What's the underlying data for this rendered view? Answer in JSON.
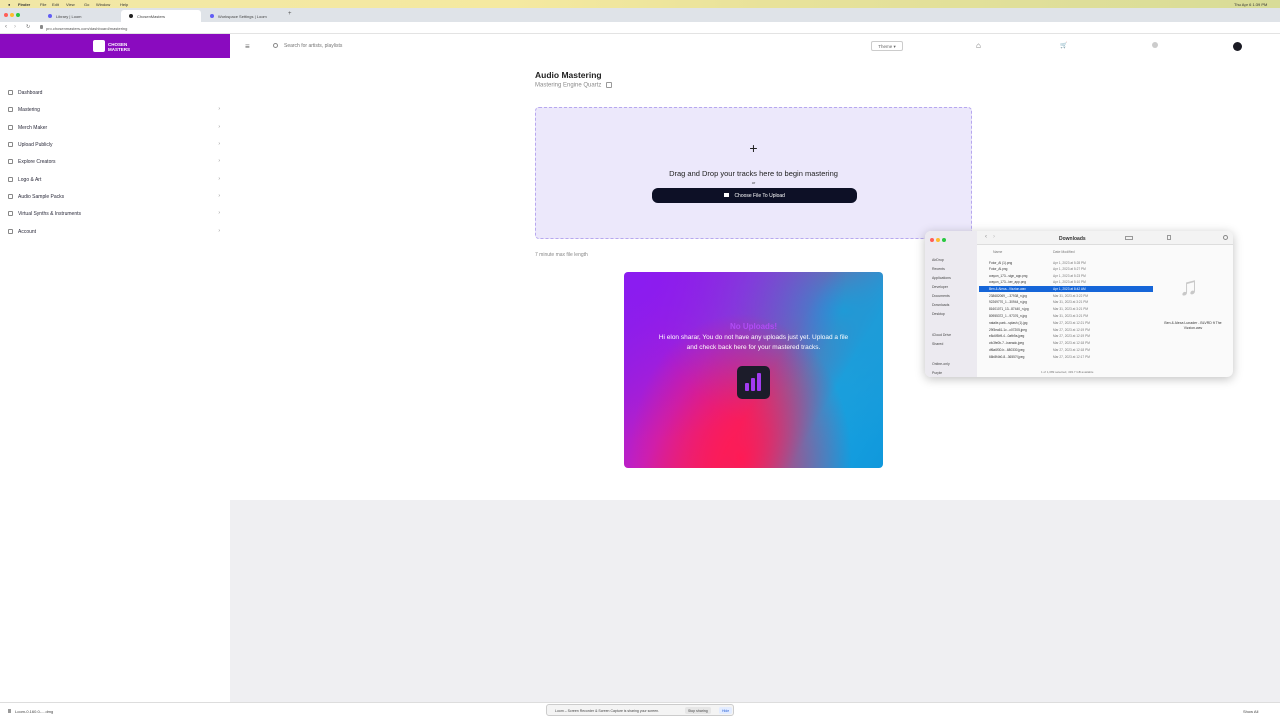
{
  "menubar": {
    "app": "Finder",
    "items": [
      "File",
      "Edit",
      "View",
      "Go",
      "Window",
      "Help"
    ],
    "clock": "Thu Apr 6 1:39 PM"
  },
  "browser": {
    "tabs": [
      {
        "label": "Library | Loom",
        "color": "#625df5"
      },
      {
        "label": "ChosenMasters",
        "color": "#222222"
      },
      {
        "label": "Workspace Settings | Loom",
        "color": "#625df5"
      }
    ],
    "url": "pro.chosenmasters.com/dashboard/mastering"
  },
  "brand": {
    "logo_text_1": "CHOSEN",
    "logo_text_2": "MASTERS",
    "color": "#8a0bbf"
  },
  "topbar": {
    "search_placeholder": "Search for artists, playlists",
    "theme_label": "Theme"
  },
  "sidebar": {
    "items": [
      {
        "label": "Dashboard",
        "chevron": ""
      },
      {
        "label": "Mastering",
        "chevron": "›"
      },
      {
        "label": "Merch Maker",
        "chevron": "›"
      },
      {
        "label": "Upload Publicly",
        "chevron": "›"
      },
      {
        "label": "Explore Creators",
        "chevron": "›"
      },
      {
        "label": "Logo & Art",
        "chevron": "›"
      },
      {
        "label": "Audio Sample Packs",
        "chevron": "›"
      },
      {
        "label": "Virtual Synths & Instruments",
        "chevron": "›"
      },
      {
        "label": "Account",
        "chevron": "›"
      }
    ]
  },
  "main": {
    "title": "Audio Mastering",
    "subtitle": "Mastering Engine Quartz",
    "dropzone": {
      "plus": "+",
      "text": "Drag and Drop your tracks here to begin mastering",
      "or": "or",
      "button": "Choose File To Upload"
    },
    "max_length": "7 minute max file length",
    "empty_card": {
      "title": "No Uploads!",
      "message": "Hi elon sharar, You do not have any uploads just yet. Upload a file and check back here for your mastered tracks."
    }
  },
  "finder": {
    "title": "Downloads",
    "sidebar": [
      "AirDrop",
      "Recents",
      "Applications",
      "Developer",
      "Documents",
      "Downloads",
      "Desktop",
      "iCloud Drive",
      "Shared",
      "Online-only",
      "Purple"
    ],
    "column_name": "Name",
    "column_date": "Date Modified",
    "files": [
      {
        "name": "Fotor_AI (1).png",
        "date": "Apr 1, 2023 at 5:28 PM",
        "selected": false
      },
      {
        "name": "Fotor_AI.png",
        "date": "Apr 1, 2023 at 5:27 PM",
        "selected": false
      },
      {
        "name": "crayon_173...sign_app.png",
        "date": "Apr 1, 2023 at 5:23 PM",
        "selected": false
      },
      {
        "name": "crayon_173...ker_app.png",
        "date": "Apr 1, 2023 at 5:10 PM",
        "selected": false
      },
      {
        "name": "Ben & Alexa...Vizzion.wav",
        "date": "Apr 1, 2023 at 8:42 AM",
        "selected": true
      },
      {
        "name": "238682069_...37938_n.jpg",
        "date": "Mar 31, 2023 at 3:22 PM",
        "selected": false
      },
      {
        "name": "92269770_1...30944_n.jpg",
        "date": "Mar 31, 2023 at 3:21 PM",
        "selected": false
      },
      {
        "name": "81601071_13...87440_n.jpg",
        "date": "Mar 31, 2023 at 3:21 PM",
        "selected": false
      },
      {
        "name": "80955372_1...97376_n.jpg",
        "date": "Mar 31, 2023 at 3:21 PM",
        "selected": false
      },
      {
        "name": "natalie-park...splash (1).jpg",
        "date": "Mar 27, 2023 at 12:21 PM",
        "selected": false
      },
      {
        "name": "29f3ea61-1c...c07205.jpeg",
        "date": "Mar 27, 2023 at 12:19 PM",
        "selected": false
      },
      {
        "name": "e8c6f5b9-4...0afb9a.jpeg",
        "date": "Mar 27, 2023 at 12:19 PM",
        "selected": false
      },
      {
        "name": "cfc3fe0b-7...baeadc.jpeg",
        "date": "Mar 27, 2023 at 12:18 PM",
        "selected": false
      },
      {
        "name": "df6a6f30-b...680330.jpeg",
        "date": "Mar 27, 2023 at 12:18 PM",
        "selected": false
      },
      {
        "name": "66b8f4b0-8...36557f.jpeg",
        "date": "Mar 27, 2023 at 12:17 PM",
        "selected": false
      }
    ],
    "preview_name": "Ben & Alexa Lunader - BLVRD ft The Vizzion.wav",
    "status": "1 of 1,089 selected, 493.7 GB available"
  },
  "bottom": {
    "download_name": "Loom-0.160.0-....dmg",
    "share_text": "Loom – Screen Recorder & Screen Capture is sharing your screen.",
    "stop_label": "Stop sharing",
    "hide_label": "Hide",
    "show_all": "Show All"
  }
}
